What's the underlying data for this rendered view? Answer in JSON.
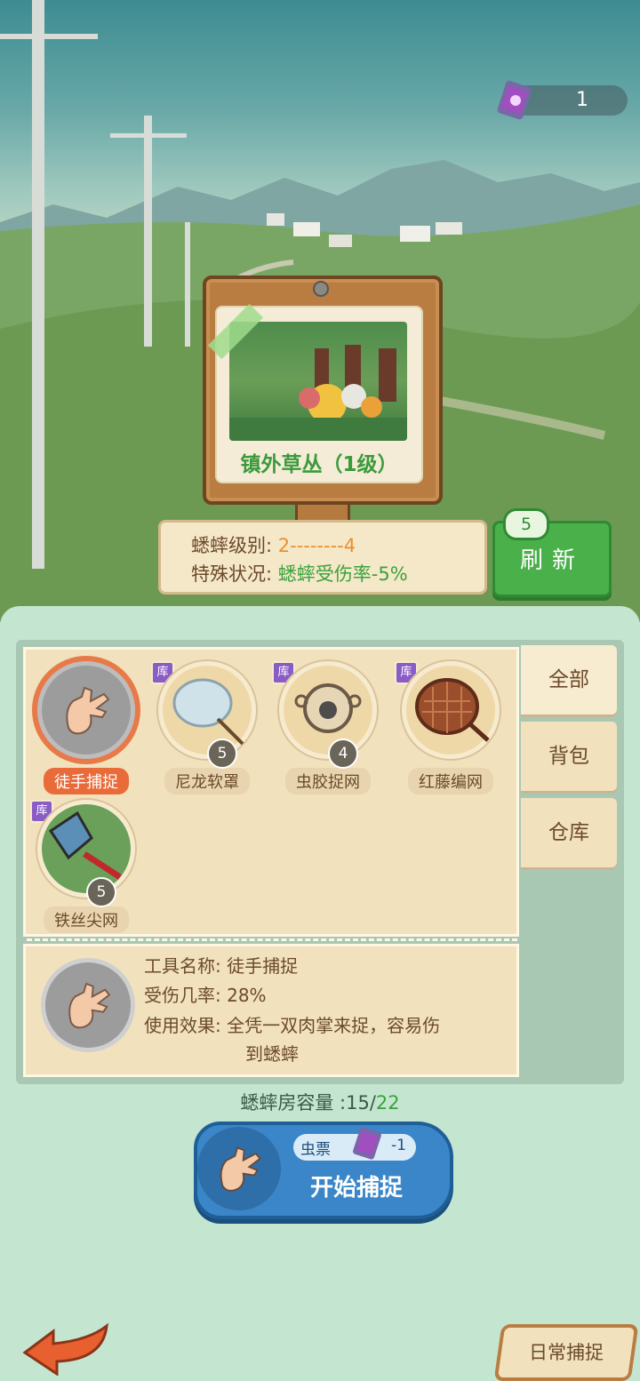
{
  "header": {
    "ticket_count": "1",
    "ticket_icon": "bug-ticket-icon"
  },
  "location": {
    "name": "镇外草丛（1级）"
  },
  "info": {
    "level_label": "蟋蟀级别:",
    "level_value": "2--------4",
    "status_label": "特殊状况:",
    "status_value": "蟋蟀受伤率-5%"
  },
  "refresh": {
    "label": "刷新",
    "count": "5"
  },
  "tabs": [
    {
      "label": "全部",
      "active": true
    },
    {
      "label": "背包",
      "active": false
    },
    {
      "label": "仓库",
      "active": false
    }
  ],
  "tools": [
    {
      "label": "徒手捕捉",
      "count": "",
      "ku": "",
      "selected": true,
      "icon": "hand-icon"
    },
    {
      "label": "尼龙软罩",
      "count": "5",
      "ku": "库",
      "selected": false,
      "icon": "nylon-net-icon"
    },
    {
      "label": "虫胶捉网",
      "count": "4",
      "ku": "库",
      "selected": false,
      "icon": "shellac-net-icon"
    },
    {
      "label": "红藤编网",
      "count": "",
      "ku": "库",
      "selected": false,
      "icon": "rattan-net-icon"
    },
    {
      "label": "铁丝尖网",
      "count": "5",
      "ku": "库",
      "selected": false,
      "icon": "wire-net-icon"
    }
  ],
  "detail": {
    "name_label": "工具名称:",
    "name_value": "徒手捕捉",
    "rate_label": "受伤几率:",
    "rate_value": "28%",
    "effect_label": "使用效果:",
    "effect_line1": "全凭一双肉掌来捉，容易伤",
    "effect_line2": "到蟋蟀"
  },
  "capacity": {
    "label": "蟋蟀房容量 :",
    "current": "15",
    "sep": "/",
    "max": "22"
  },
  "start": {
    "ticket_label": "虫票",
    "ticket_cost": "-1",
    "label": "开始捕捉"
  },
  "daily": {
    "label": "日常捕捉"
  },
  "colors": {
    "accent_green": "#3aa23c",
    "accent_orange": "#e8912b",
    "selected": "#e96b3a",
    "button_blue": "#3a86c8"
  }
}
